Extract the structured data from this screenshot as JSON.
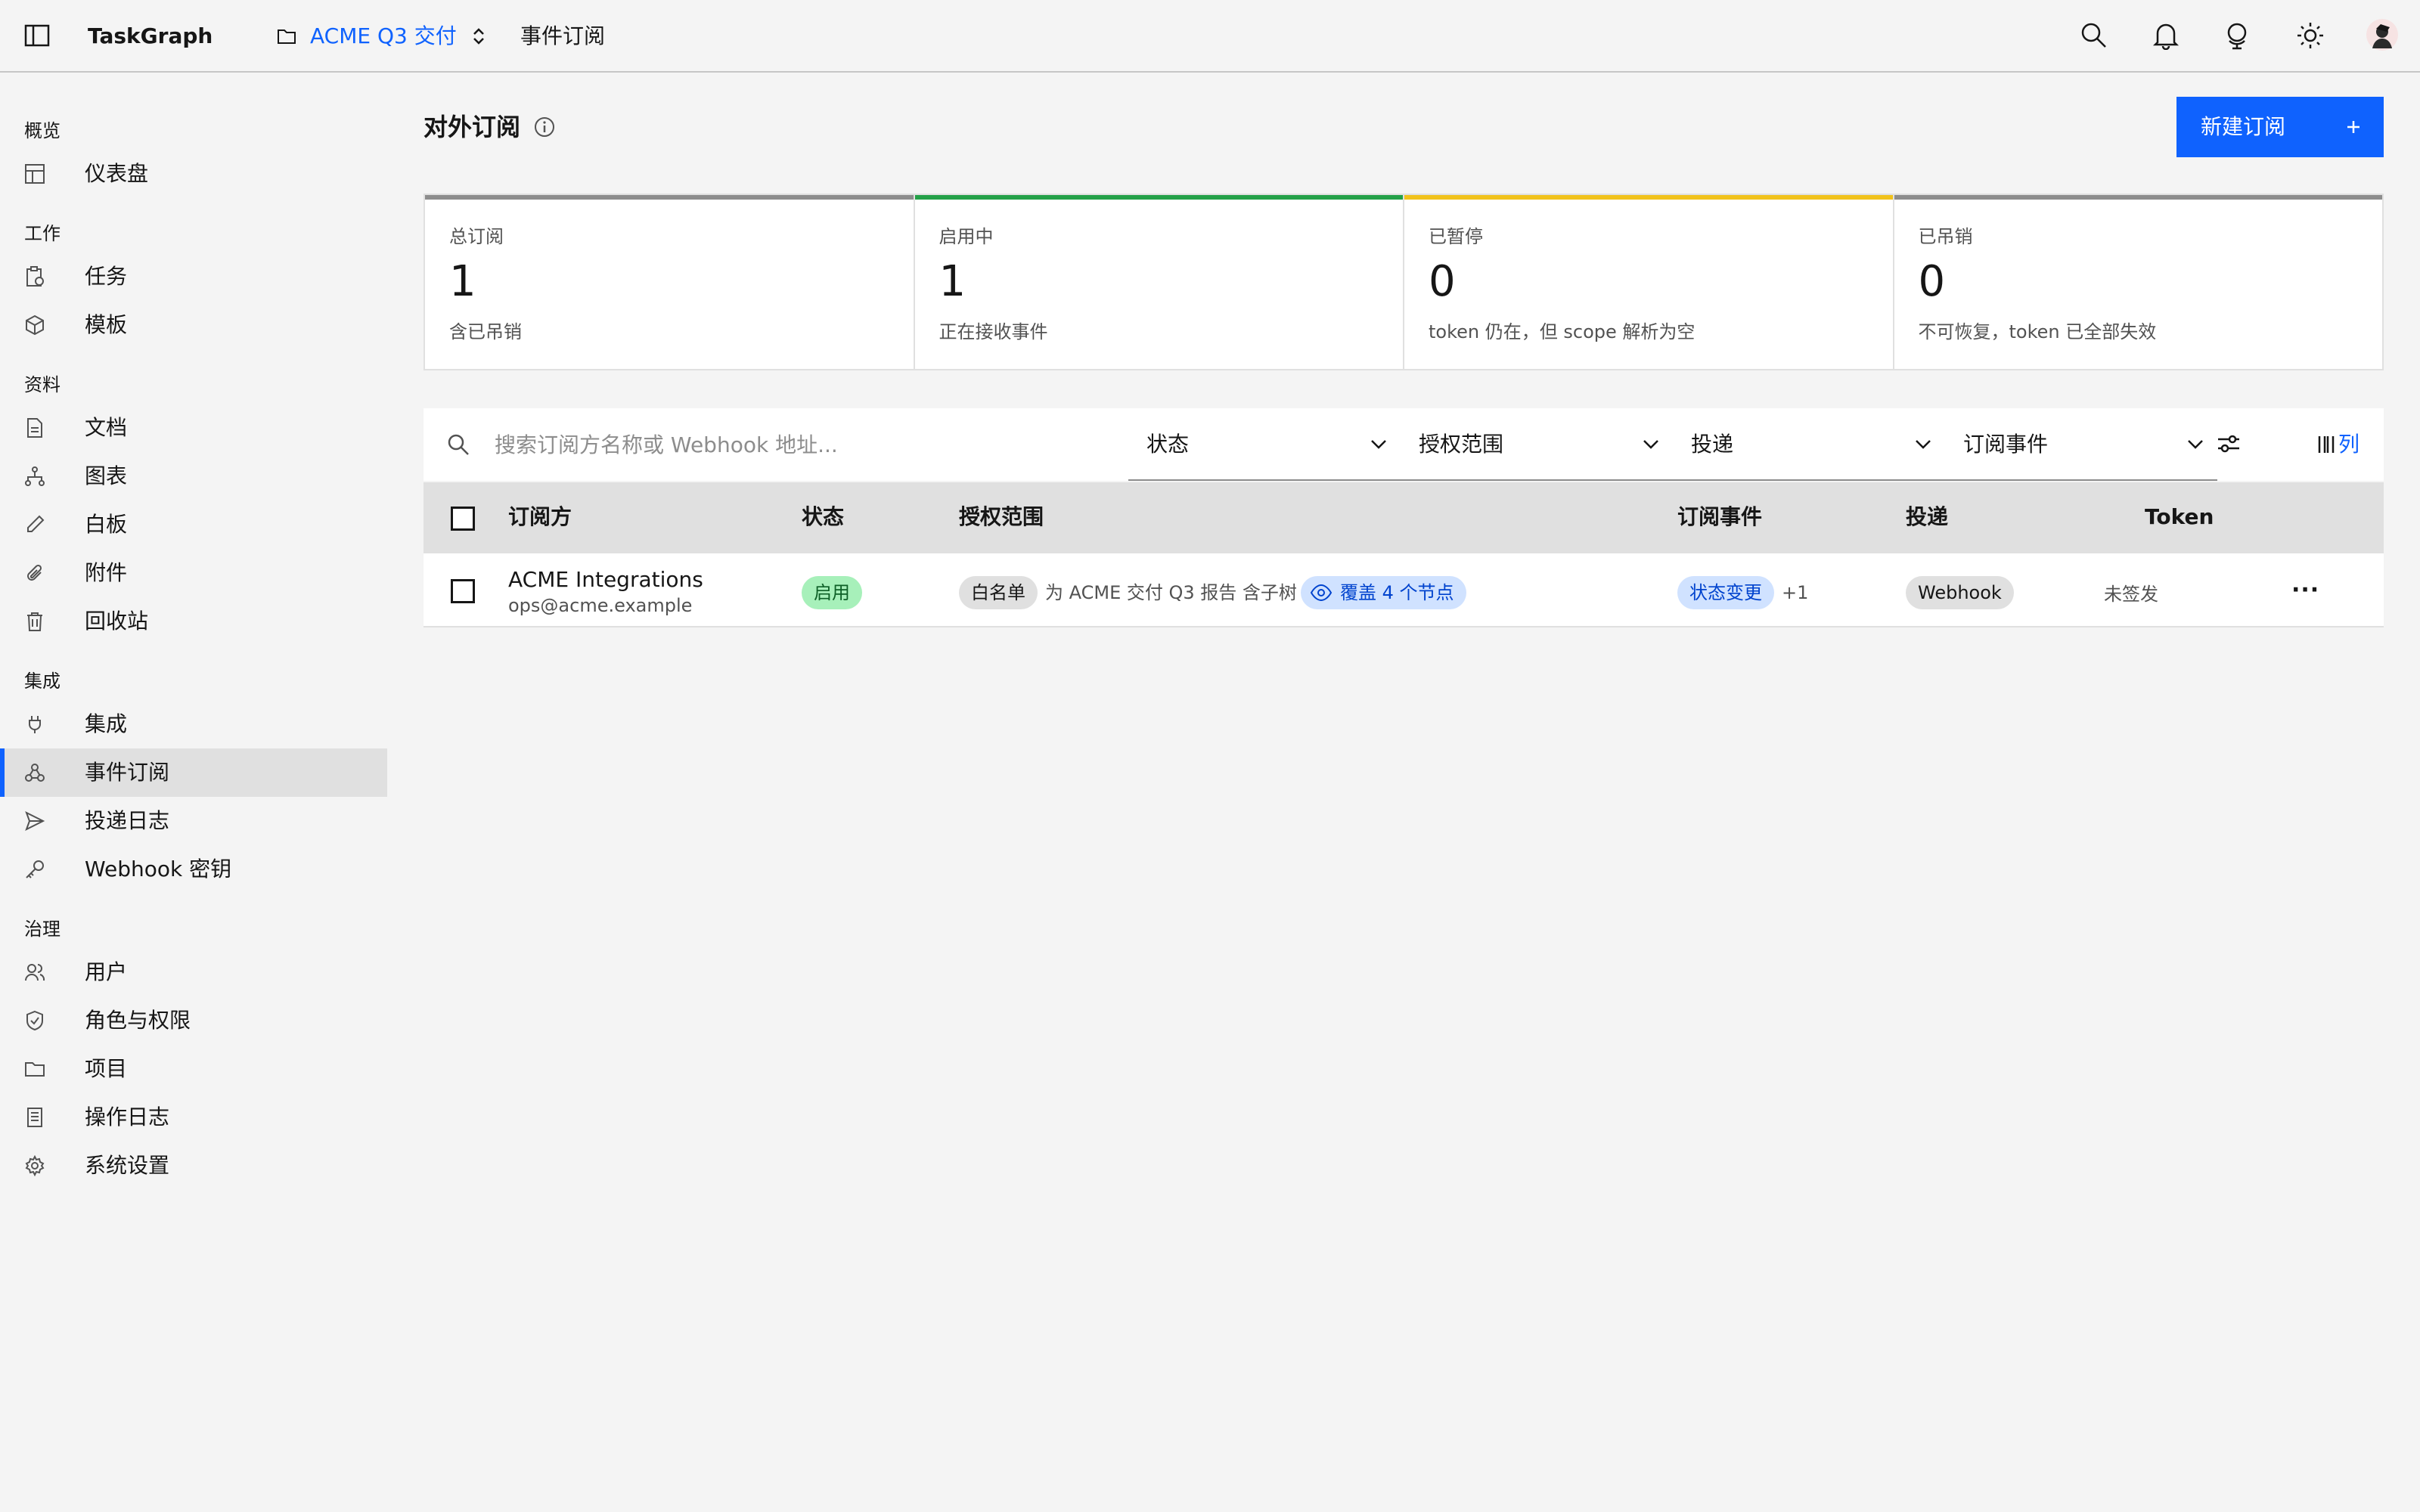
{
  "header": {
    "app_name": "TaskGraph",
    "project_name": "ACME Q3 交付",
    "breadcrumb": "事件订阅"
  },
  "sidebar": {
    "sections": [
      {
        "title": "概览",
        "items": [
          {
            "label": "仪表盘",
            "icon": "dashboard-icon"
          }
        ]
      },
      {
        "title": "工作",
        "items": [
          {
            "label": "任务",
            "icon": "task-icon"
          },
          {
            "label": "模板",
            "icon": "template-icon"
          }
        ]
      },
      {
        "title": "资料",
        "items": [
          {
            "label": "文档",
            "icon": "document-icon"
          },
          {
            "label": "图表",
            "icon": "diagram-icon"
          },
          {
            "label": "白板",
            "icon": "whiteboard-icon"
          },
          {
            "label": "附件",
            "icon": "attachment-icon"
          },
          {
            "label": "回收站",
            "icon": "trash-icon"
          }
        ]
      },
      {
        "title": "集成",
        "items": [
          {
            "label": "集成",
            "icon": "plug-icon"
          },
          {
            "label": "事件订阅",
            "icon": "webhook-icon",
            "active": true
          },
          {
            "label": "投递日志",
            "icon": "send-icon"
          },
          {
            "label": "Webhook 密钥",
            "icon": "key-icon"
          }
        ]
      },
      {
        "title": "治理",
        "items": [
          {
            "label": "用户",
            "icon": "users-icon"
          },
          {
            "label": "角色与权限",
            "icon": "shield-icon"
          },
          {
            "label": "项目",
            "icon": "folder-icon"
          },
          {
            "label": "操作日志",
            "icon": "log-icon"
          },
          {
            "label": "系统设置",
            "icon": "gear-icon"
          }
        ]
      }
    ]
  },
  "page": {
    "title": "对外订阅",
    "new_button": "新建订阅"
  },
  "stats": [
    {
      "label": "总订阅",
      "value": "1",
      "desc": "含已吊销",
      "color": "#8d8d8d"
    },
    {
      "label": "启用中",
      "value": "1",
      "desc": "正在接收事件",
      "color": "#24a148"
    },
    {
      "label": "已暂停",
      "value": "0",
      "desc": "token 仍在，但 scope 解析为空",
      "color": "#f1c21b"
    },
    {
      "label": "已吊销",
      "value": "0",
      "desc": "不可恢复，token 已全部失效",
      "color": "#8d8d8d"
    }
  ],
  "toolbar": {
    "search_placeholder": "搜索订阅方名称或 Webhook 地址...",
    "filters": {
      "status": "状态",
      "scope": "授权范围",
      "delivery": "投递",
      "events": "订阅事件"
    },
    "columns_label": "列"
  },
  "table": {
    "headers": {
      "subscriber": "订阅方",
      "status": "状态",
      "scope": "授权范围",
      "events": "订阅事件",
      "delivery": "投递",
      "token": "Token"
    },
    "rows": [
      {
        "name": "ACME Integrations",
        "email": "ops@acme.example",
        "status": "启用",
        "scope_mode": "白名单",
        "scope_text": "为 ACME 交付 Q3 报告 含子树",
        "scope_cover": "覆盖 4 个节点",
        "event": "状态变更",
        "event_more": "+1",
        "delivery": "Webhook",
        "token": "未签发"
      }
    ]
  },
  "colors": {
    "accent": "#0f62fe",
    "active_bg": "#e0e0e0"
  }
}
